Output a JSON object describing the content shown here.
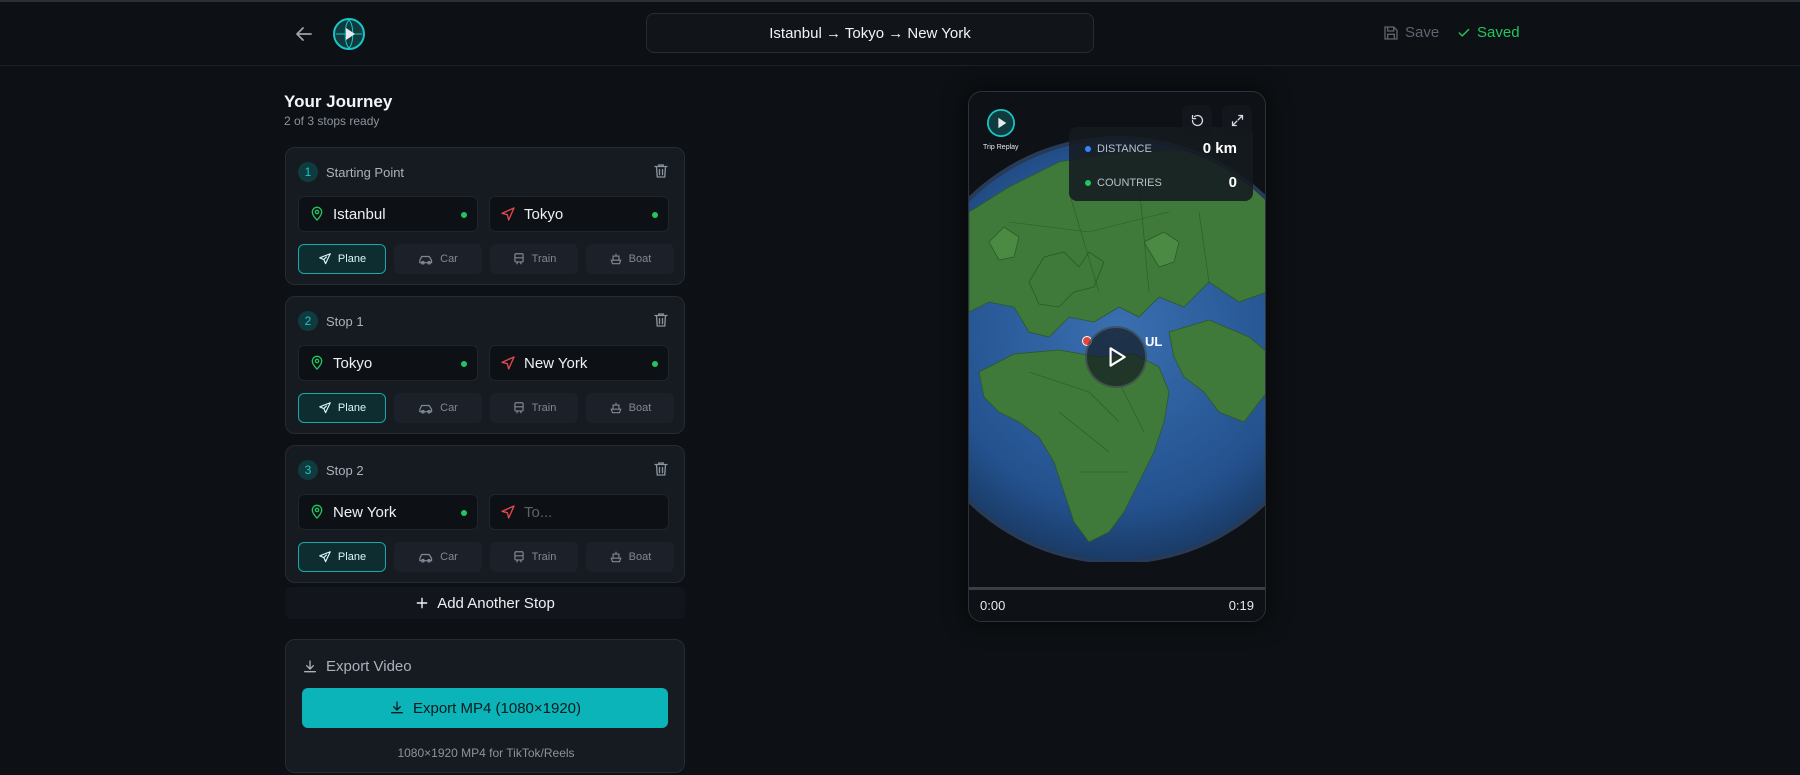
{
  "header": {
    "title": "Istanbul → Tokyo → New York",
    "save_label": "Save",
    "saved_label": "Saved"
  },
  "journey": {
    "title": "Your Journey",
    "subtitle": "2 of 3 stops ready"
  },
  "stops": [
    {
      "number": "1",
      "label": "Starting Point",
      "from": "Istanbul",
      "to": "Tokyo",
      "to_placeholder": "To...",
      "mode": "Plane"
    },
    {
      "number": "2",
      "label": "Stop 1",
      "from": "Tokyo",
      "to": "New York",
      "to_placeholder": "To...",
      "mode": "Plane"
    },
    {
      "number": "3",
      "label": "Stop 2",
      "from": "New York",
      "to": "",
      "to_placeholder": "To...",
      "mode": "Plane"
    }
  ],
  "modes": [
    "Plane",
    "Car",
    "Train",
    "Boat"
  ],
  "add_stop_label": "Add Another Stop",
  "export": {
    "title": "Export Video",
    "button": "Export MP4 (1080×1920)",
    "note": "1080×1920 MP4 for TikTok/Reels"
  },
  "preview": {
    "brand": "Trip Replay",
    "stats": [
      {
        "label": "DISTANCE",
        "value": "0 km",
        "color": "#3b82f6"
      },
      {
        "label": "COUNTRIES",
        "value": "0",
        "color": "#22c55e"
      }
    ],
    "city_label": "UL",
    "time_current": "0:00",
    "time_total": "0:19",
    "progress": 0
  },
  "colors": {
    "accent": "#0ab4b8",
    "success": "#22c55e",
    "background": "#0d1014"
  }
}
